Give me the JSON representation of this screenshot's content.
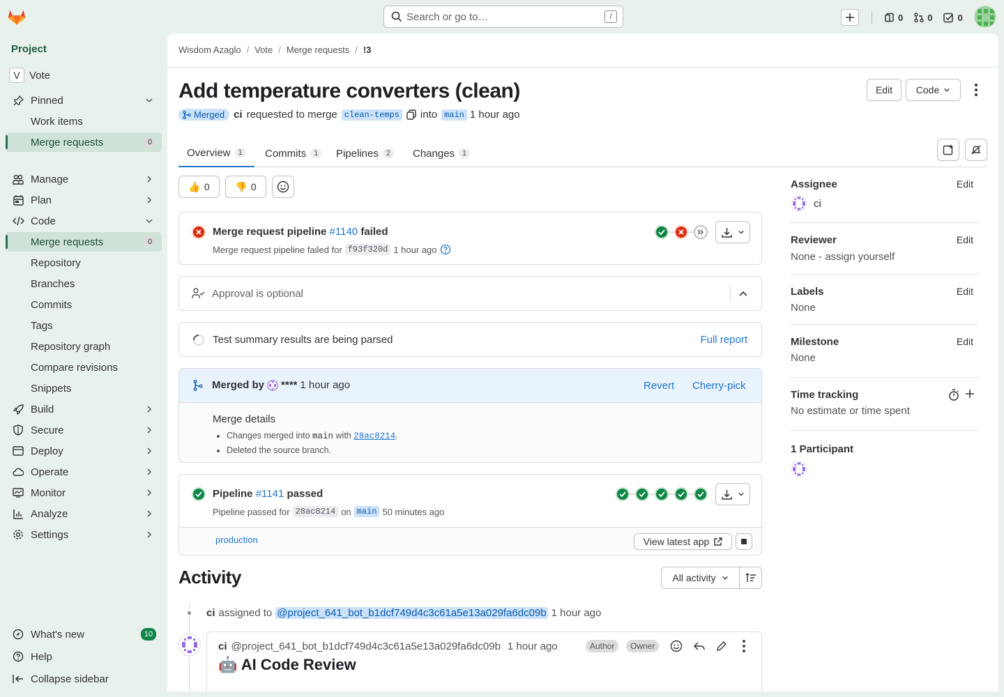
{
  "topbar": {
    "search_placeholder": "Search or go to…",
    "search_shortcut": "/",
    "issues_count": "0",
    "mr_count": "0",
    "todo_count": "0"
  },
  "sidebar": {
    "section_title": "Project",
    "project_initial": "V",
    "project_name": "Vote",
    "pinned_label": "Pinned",
    "pinned_items": [
      {
        "label": "Work items"
      },
      {
        "label": "Merge requests",
        "count": "0"
      }
    ],
    "groups": [
      {
        "label": "Manage"
      },
      {
        "label": "Plan"
      },
      {
        "label": "Code"
      }
    ],
    "code_items": [
      {
        "label": "Merge requests",
        "count": "0"
      },
      {
        "label": "Repository"
      },
      {
        "label": "Branches"
      },
      {
        "label": "Commits"
      },
      {
        "label": "Tags"
      },
      {
        "label": "Repository graph"
      },
      {
        "label": "Compare revisions"
      },
      {
        "label": "Snippets"
      }
    ],
    "more_groups": [
      {
        "label": "Build"
      },
      {
        "label": "Secure"
      },
      {
        "label": "Deploy"
      },
      {
        "label": "Operate"
      },
      {
        "label": "Monitor"
      },
      {
        "label": "Analyze"
      },
      {
        "label": "Settings"
      }
    ],
    "footer": {
      "whats_new": "What's new",
      "whats_new_count": "10",
      "help": "Help",
      "collapse": "Collapse sidebar"
    }
  },
  "breadcrumb": [
    "Wisdom Azaglo",
    "Vote",
    "Merge requests",
    "!3"
  ],
  "mr": {
    "title": "Add temperature converters (clean)",
    "edit_label": "Edit",
    "code_label": "Code",
    "status": "Merged",
    "author": "ci",
    "requested_text": "requested to merge",
    "source_branch": "clean-temps",
    "into_text": "into",
    "target_branch": "main",
    "time": "1 hour ago"
  },
  "tabs": [
    {
      "label": "Overview",
      "count": "1"
    },
    {
      "label": "Commits",
      "count": "1"
    },
    {
      "label": "Pipelines",
      "count": "2"
    },
    {
      "label": "Changes",
      "count": "1"
    }
  ],
  "reactions": {
    "thumbs_up": "0",
    "thumbs_down": "0"
  },
  "pipeline_failed": {
    "title_prefix": "Merge request pipeline",
    "id": "#1140",
    "status_word": "failed",
    "subtitle_prefix": "Merge request pipeline failed for",
    "sha": "f93f320d",
    "time": "1 hour ago"
  },
  "approval": {
    "text": "Approval is optional"
  },
  "test_summary": {
    "text": "Test summary results are being parsed",
    "link": "Full report"
  },
  "merged": {
    "label": "Merged by",
    "user": "****",
    "time": "1 hour ago",
    "revert": "Revert",
    "cherry_pick": "Cherry-pick",
    "details_title": "Merge details",
    "line1_prefix": "Changes merged into",
    "line1_branch": "main",
    "line1_with": "with",
    "line1_sha": "28ac8214",
    "line2": "Deleted the source branch."
  },
  "pipeline_passed": {
    "title_prefix": "Pipeline",
    "id": "#1141",
    "status_word": "passed",
    "subtitle_prefix": "Pipeline passed for",
    "sha": "28ac8214",
    "on_text": "on",
    "branch": "main",
    "time": "50 minutes ago",
    "environment": "production",
    "view_app": "View latest app"
  },
  "activity": {
    "title": "Activity",
    "filter": "All activity",
    "event_user": "ci",
    "event_text": "assigned to",
    "event_target": "@project_641_bot_b1dcf749d4c3c61a5e13a029fa6dc09b",
    "event_time": "1 hour ago",
    "comment_user": "ci",
    "comment_handle": "@project_641_bot_b1dcf749d4c3c61a5e13a029fa6dc09b",
    "comment_time": "1 hour ago",
    "badge_author": "Author",
    "badge_owner": "Owner",
    "comment_heading": "🤖 AI Code Review"
  },
  "right_sidebar": {
    "assignee_label": "Assignee",
    "assignee_value": "ci",
    "reviewer_label": "Reviewer",
    "reviewer_value": "None - assign yourself",
    "labels_label": "Labels",
    "labels_value": "None",
    "milestone_label": "Milestone",
    "milestone_value": "None",
    "time_label": "Time tracking",
    "time_value": "No estimate or time spent",
    "participants_label": "1 Participant",
    "edit": "Edit"
  },
  "colors": {
    "brand_orange": "#e24329",
    "sidebar_bg": "#e9f1ec",
    "link": "#1f75cb",
    "success": "#108548",
    "danger": "#dd2b0e"
  }
}
